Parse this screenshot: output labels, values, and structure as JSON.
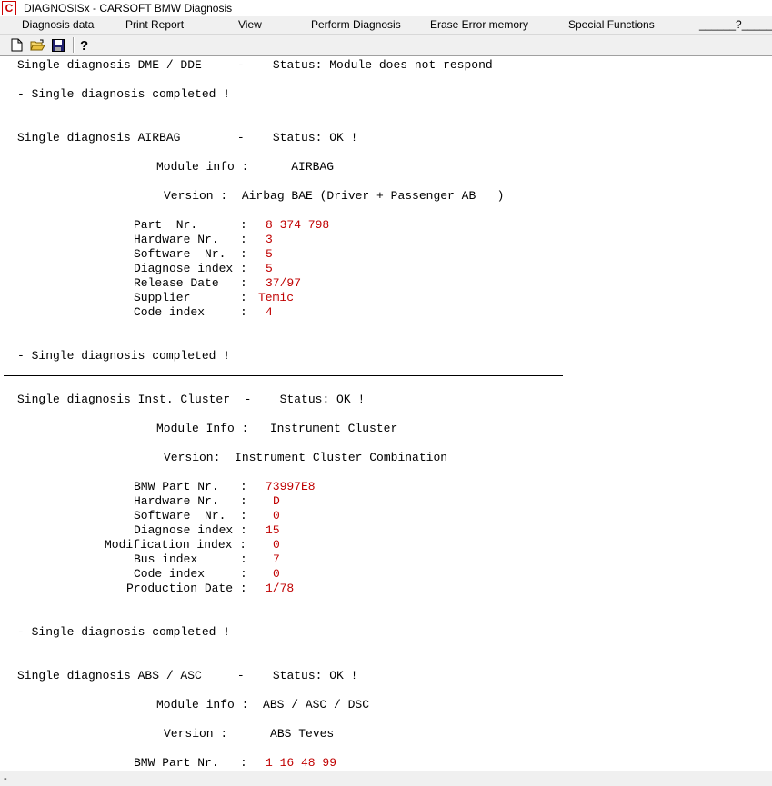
{
  "window": {
    "title": "DIAGNOSISx - CARSOFT BMW Diagnosis",
    "icon_letter": "C"
  },
  "menu": {
    "diagnosis_data": "Diagnosis data",
    "print_report": "Print Report",
    "view": "View",
    "perform_diagnosis": "Perform Diagnosis",
    "erase_error_memory": "Erase Error memory",
    "special_functions": "Special Functions",
    "help": "______?______"
  },
  "toolbar": {
    "icons": [
      "new-file-icon",
      "open-folder-icon",
      "save-disk-icon",
      "help-icon"
    ]
  },
  "report": {
    "dme": {
      "header": "Single diagnosis DME / DDE     -    Status: Module does not respond",
      "completed": "- Single diagnosis completed !"
    },
    "airbag": {
      "header": "Single diagnosis AIRBAG        -    Status: OK !",
      "module_info": "Module info :      AIRBAG",
      "version": "Version :  Airbag BAE (Driver + Passenger AB   )",
      "fields": [
        {
          "label": "Part  Nr.      :",
          "value": "8 374 798"
        },
        {
          "label": "Hardware Nr.   :",
          "value": "3"
        },
        {
          "label": "Software  Nr.  :",
          "value": "5"
        },
        {
          "label": "Diagnose index :",
          "value": "5"
        },
        {
          "label": "Release Date   :",
          "value": "37/97"
        },
        {
          "label": "Supplier       :",
          "value": "Temic"
        },
        {
          "label": "Code index     :",
          "value": "4"
        }
      ],
      "completed": "- Single diagnosis completed !"
    },
    "cluster": {
      "header": "Single diagnosis Inst. Cluster  -    Status: OK !",
      "module_info": "Module Info :   Instrument Cluster",
      "version": "Version:  Instrument Cluster Combination",
      "fields": [
        {
          "label": "BMW Part Nr.   :",
          "value": "73997E8"
        },
        {
          "label": "Hardware Nr.   :",
          "value": "D"
        },
        {
          "label": "Software  Nr.  :",
          "value": "0"
        },
        {
          "label": "Diagnose index :",
          "value": "15"
        },
        {
          "label": "Modification index :",
          "value": "0"
        },
        {
          "label": "Bus index      :",
          "value": "7"
        },
        {
          "label": "Code index     :",
          "value": "0"
        },
        {
          "label": "Production Date :",
          "value": "1/78"
        }
      ],
      "completed": "- Single diagnosis completed !"
    },
    "abs": {
      "header": "Single diagnosis ABS / ASC     -    Status: OK !",
      "module_info": "Module info :  ABS / ASC / DSC",
      "version": "Version :      ABS Teves",
      "fields": [
        {
          "label": "BMW Part Nr.   :",
          "value": "1 16 48 99"
        }
      ]
    }
  },
  "statusbar": {
    "text": "-"
  }
}
